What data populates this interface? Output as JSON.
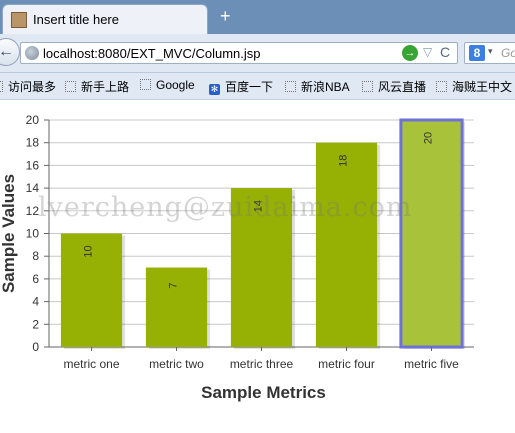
{
  "window": {
    "tab_title": "Insert title here",
    "new_tab_label": "+",
    "back_label": "←",
    "url": "localhost:8080/EXT_MVC/Column.jsp",
    "go_label": "→",
    "star_label": "▽",
    "reload_label": "C",
    "search_engine_label": "8",
    "search_dropdown": "▾",
    "search_placeholder": "Go"
  },
  "bookmarks": [
    {
      "label": "访问最多",
      "icon": "dotted-page-icon"
    },
    {
      "label": "新手上路",
      "icon": "dotted-page-icon"
    },
    {
      "label": "Google",
      "icon": "dotted-page-icon"
    },
    {
      "label": "百度一下",
      "icon": "paw-icon"
    },
    {
      "label": "新浪NBA",
      "icon": "dotted-page-icon"
    },
    {
      "label": "风云直播",
      "icon": "dotted-page-icon"
    },
    {
      "label": "海贼王中文",
      "icon": "dotted-page-icon"
    }
  ],
  "watermark": "lvercheng@zuidaima.com",
  "colors": {
    "bar_fill": "#96b003",
    "bar_highlight_fill": "#a8c23a",
    "bar_highlight_border": "#6d71d9",
    "grid": "#c8c8c8",
    "axis": "#666666"
  },
  "chart_data": {
    "type": "bar",
    "categories": [
      "metric one",
      "metric two",
      "metric three",
      "metric four",
      "metric five"
    ],
    "values": [
      10,
      7,
      14,
      18,
      20
    ],
    "xlabel": "Sample Metrics",
    "ylabel": "Sample Values",
    "ylim": [
      0,
      20
    ],
    "yticks": [
      0,
      2,
      4,
      6,
      8,
      10,
      12,
      14,
      16,
      18,
      20
    ],
    "grid": true,
    "highlighted_category": "metric five",
    "data_labels": true
  }
}
